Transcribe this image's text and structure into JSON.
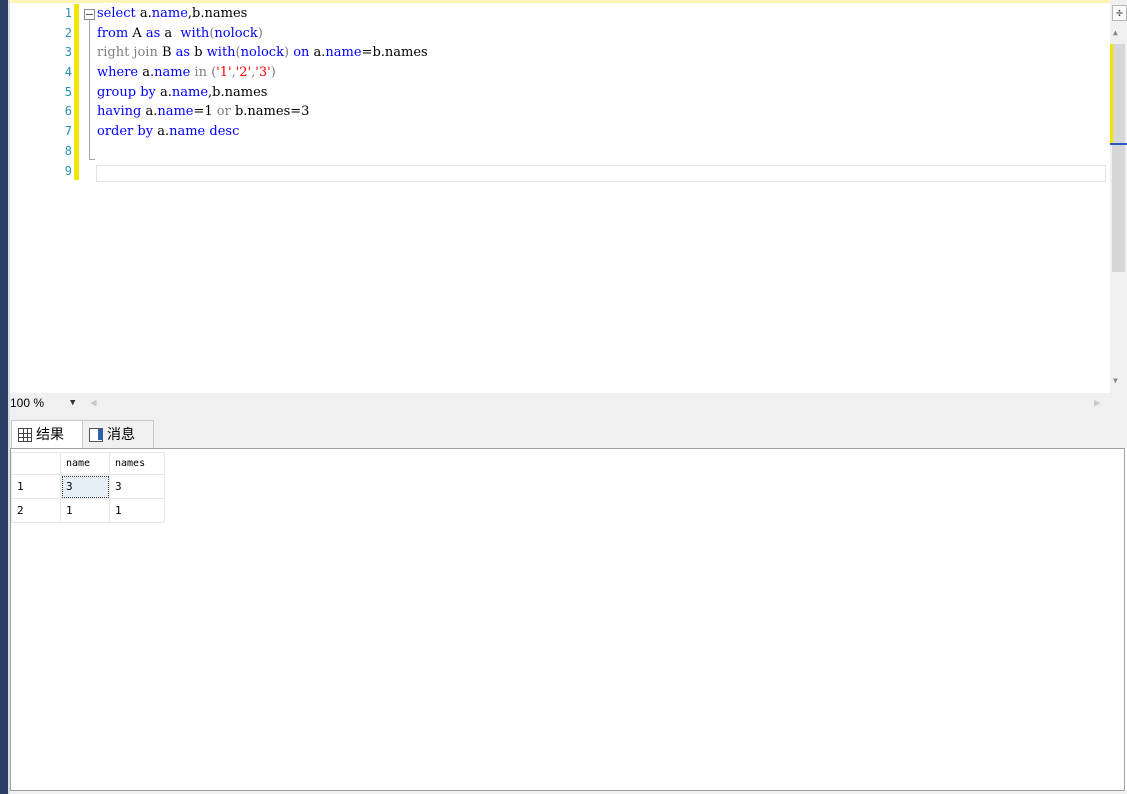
{
  "editor": {
    "line_numbers": [
      "1",
      "2",
      "3",
      "4",
      "5",
      "6",
      "7",
      "8",
      "9"
    ],
    "lines": [
      [
        {
          "t": "select",
          "c": "kw"
        },
        {
          "t": " a.",
          "c": "pl"
        },
        {
          "t": "name",
          "c": "kw"
        },
        {
          "t": ",b.names",
          "c": "pl"
        }
      ],
      [
        {
          "t": "from",
          "c": "kw"
        },
        {
          "t": " A ",
          "c": "pl"
        },
        {
          "t": "as",
          "c": "kw"
        },
        {
          "t": " a  ",
          "c": "pl"
        },
        {
          "t": "with",
          "c": "kw"
        },
        {
          "t": "(",
          "c": "gr"
        },
        {
          "t": "nolock",
          "c": "kw"
        },
        {
          "t": ")",
          "c": "gr"
        }
      ],
      [
        {
          "t": "right join",
          "c": "gr"
        },
        {
          "t": " B ",
          "c": "pl"
        },
        {
          "t": "as",
          "c": "kw"
        },
        {
          "t": " b ",
          "c": "pl"
        },
        {
          "t": "with",
          "c": "kw"
        },
        {
          "t": "(",
          "c": "gr"
        },
        {
          "t": "nolock",
          "c": "kw"
        },
        {
          "t": ")",
          "c": "gr"
        },
        {
          "t": " ",
          "c": "pl"
        },
        {
          "t": "on",
          "c": "kw"
        },
        {
          "t": " a.",
          "c": "pl"
        },
        {
          "t": "name",
          "c": "kw"
        },
        {
          "t": "=b.names",
          "c": "pl"
        }
      ],
      [
        {
          "t": "where",
          "c": "kw"
        },
        {
          "t": " a.",
          "c": "pl"
        },
        {
          "t": "name",
          "c": "kw"
        },
        {
          "t": " ",
          "c": "pl"
        },
        {
          "t": "in",
          "c": "gr"
        },
        {
          "t": " (",
          "c": "gr"
        },
        {
          "t": "'1'",
          "c": "st"
        },
        {
          "t": ",",
          "c": "gr"
        },
        {
          "t": "'2'",
          "c": "st"
        },
        {
          "t": ",",
          "c": "gr"
        },
        {
          "t": "'3'",
          "c": "st"
        },
        {
          "t": ")",
          "c": "gr"
        }
      ],
      [
        {
          "t": "group by",
          "c": "kw"
        },
        {
          "t": " a.",
          "c": "pl"
        },
        {
          "t": "name",
          "c": "kw"
        },
        {
          "t": ",b.names",
          "c": "pl"
        }
      ],
      [
        {
          "t": "having",
          "c": "kw"
        },
        {
          "t": " a.",
          "c": "pl"
        },
        {
          "t": "name",
          "c": "kw"
        },
        {
          "t": "=1 ",
          "c": "pl"
        },
        {
          "t": "or",
          "c": "gr"
        },
        {
          "t": " b.names=3",
          "c": "pl"
        }
      ],
      [
        {
          "t": "order by",
          "c": "kw"
        },
        {
          "t": " a.",
          "c": "pl"
        },
        {
          "t": "name",
          "c": "kw"
        },
        {
          "t": " ",
          "c": "pl"
        },
        {
          "t": "desc",
          "c": "kw"
        }
      ],
      [],
      []
    ]
  },
  "toolbar": {
    "zoom": "100 %",
    "zoom_dropdown_icon": "chevron-down-icon",
    "scroll_left_icon": "chevron-left-icon",
    "scroll_right_icon": "chevron-right-icon"
  },
  "tabs": [
    {
      "label": "结果",
      "icon": "grid-icon"
    },
    {
      "label": "消息",
      "icon": "message-icon"
    }
  ],
  "results": {
    "columns": [
      "name",
      "names"
    ],
    "rows": [
      {
        "num": "1",
        "cells": [
          "3",
          "3"
        ]
      },
      {
        "num": "2",
        "cells": [
          "1",
          "1"
        ]
      }
    ]
  },
  "colors": {
    "keyword": "#0000ff",
    "operator": "#808080",
    "string": "#ff0000",
    "line_number": "#2b91af",
    "modified_marker": "#f5e300"
  }
}
